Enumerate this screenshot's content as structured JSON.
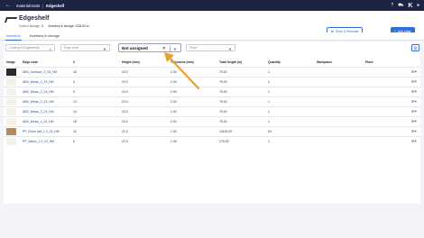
{
  "topbar": {
    "back_icon": "arrow-left-icon",
    "brand": "materialAssist",
    "page": "Edgeshelf",
    "help": "?",
    "logo": "K"
  },
  "header": {
    "title": "Edgeshelf",
    "created_label": "Code in storage: 11",
    "inventory_label": "Inventory in storage: 1234.50 m",
    "store_button": "Store & Relocate",
    "add_button": "Add edge"
  },
  "tabs": [
    {
      "label": "Inventory"
    },
    {
      "label": "Inventory in storage"
    }
  ],
  "filters": {
    "search_placeholder": "Looking in Edgebands",
    "edge_code_placeholder": "Edge code",
    "assignment_value": "Not assigned",
    "place_placeholder": "Place"
  },
  "table": {
    "columns": [
      "Image",
      "Edge code",
      "#",
      "Height (mm)",
      "Thickness (mm)",
      "Total length (m)",
      "Quantity",
      "Workplace",
      "Place"
    ],
    "rows": [
      {
        "swatch": "#2b2b2b",
        "code": "ABS_Schwarz_2_43_HM",
        "num": "18",
        "height": "43.0",
        "thickness": "2.00",
        "length": "75.00",
        "qty": "1"
      },
      {
        "swatch": "#f4f2e6",
        "code": "ABS_Weiss_2_23_HM",
        "num": "2",
        "height": "23.0",
        "thickness": "2.00",
        "length": "75.00",
        "qty": "1"
      },
      {
        "swatch": "#f4f2e6",
        "code": "ABS_Weiss_2_23_HM",
        "num": "5",
        "height": "23.0",
        "thickness": "2.00",
        "length": "75.00",
        "qty": "1"
      },
      {
        "swatch": "#f4f2e6",
        "code": "ABS_Weiss_2_23_HM",
        "num": "13",
        "height": "23.0",
        "thickness": "2.00",
        "length": "75.00",
        "qty": "1"
      },
      {
        "swatch": "#f4f2e6",
        "code": "ABS_Weiss_2_23_HM",
        "num": "14",
        "height": "23.0",
        "thickness": "2.00",
        "length": "75.00",
        "qty": "1"
      },
      {
        "swatch": "#f4f2e6",
        "code": "ABS_Weiss_2_23_HM",
        "num": "15",
        "height": "23.0",
        "thickness": "2.00",
        "length": "75.00",
        "qty": "1"
      },
      {
        "swatch": "#b48a5a",
        "code": "PP_Eiche hell_1.3_22_HM",
        "num": "10",
        "height": "22.0",
        "thickness": "1.30",
        "length": "14100.00",
        "qty": "94"
      },
      {
        "swatch": "#f4f2e6",
        "code": "PP_Weiss_1.3_22_HM",
        "num": "6",
        "height": "22.0",
        "thickness": "1.30",
        "length": "175.00",
        "qty": "1"
      }
    ]
  },
  "colors": {
    "accent": "#2f6fe0",
    "topbar": "#1b2443",
    "annotation_arrow": "#e8a425"
  },
  "icons": {
    "row_action": "playlist-add-icon",
    "filter": "filter-icon",
    "search": "search-icon",
    "settings": "gear-icon",
    "clear": "close-icon"
  }
}
